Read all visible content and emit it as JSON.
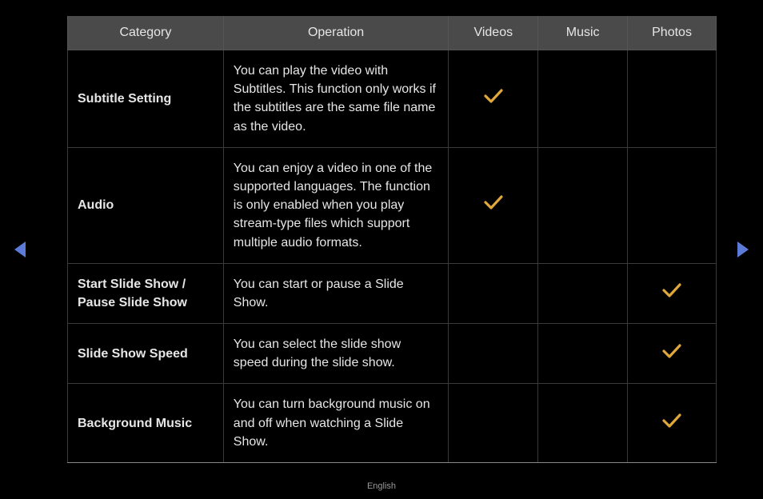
{
  "headers": {
    "category": "Category",
    "operation": "Operation",
    "videos": "Videos",
    "music": "Music",
    "photos": "Photos"
  },
  "rows": [
    {
      "category": "Subtitle Setting",
      "operation": "You can play the video with Subtitles. This function only works if the subtitles are the same file name as the video.",
      "videos": true,
      "music": false,
      "photos": false
    },
    {
      "category": "Audio",
      "operation": "You can enjoy a video in one of the supported languages. The function is only enabled when you play stream-type files which support multiple audio formats.",
      "videos": true,
      "music": false,
      "photos": false
    },
    {
      "category": "Start Slide Show / Pause Slide Show",
      "operation": "You can start or pause a Slide Show.",
      "videos": false,
      "music": false,
      "photos": true
    },
    {
      "category": "Slide Show Speed",
      "operation": "You can select the slide show speed during the slide show.",
      "videos": false,
      "music": false,
      "photos": true
    },
    {
      "category": "Background Music",
      "operation": "You can turn background music on and off when watching a Slide Show.",
      "videos": false,
      "music": false,
      "photos": true
    }
  ],
  "footer": {
    "language": "English"
  },
  "icons": {
    "check_color": "#e0a83a"
  }
}
